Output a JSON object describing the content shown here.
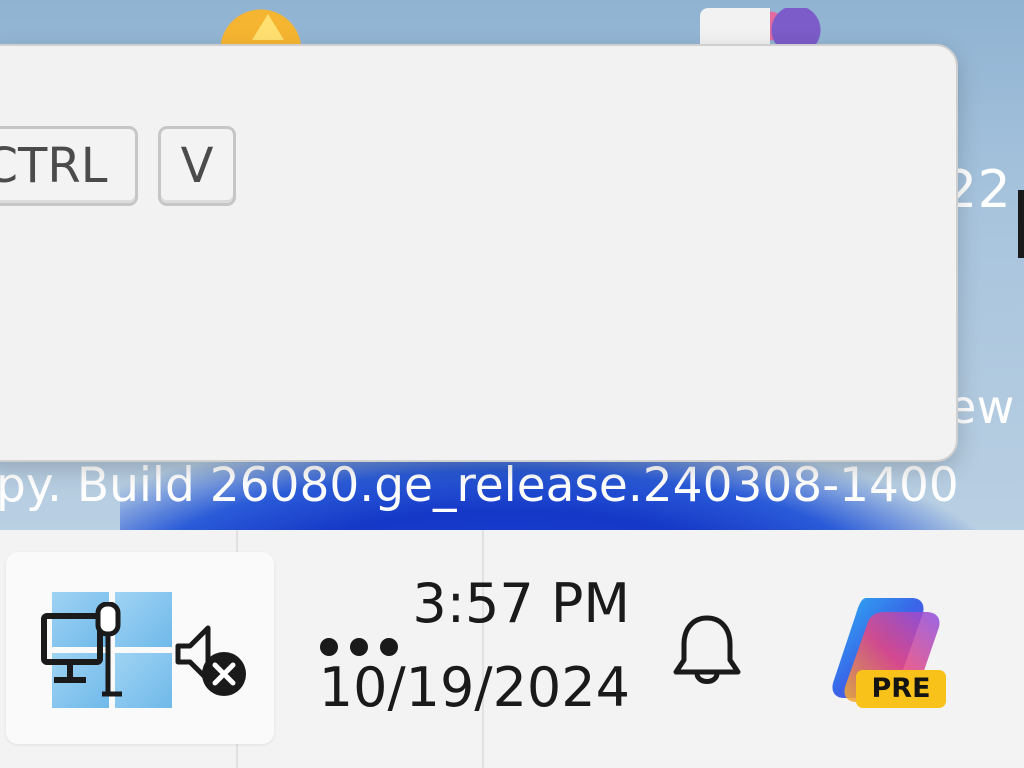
{
  "desktop": {
    "text_fragment_right_top": "22",
    "text_fragment_right_bottom": "ew",
    "watermark": "py. Build 26080.ge_release.240308-1400"
  },
  "overlay": {
    "keys": [
      "CTRL",
      "V"
    ]
  },
  "taskbar": {
    "icons": {
      "windows": "windows-start-icon",
      "network": "ethernet-network-icon",
      "volume": "volume-muted-icon",
      "overflow": "more-dots-icon",
      "notifications": "bell-icon",
      "copilot": "copilot-icon"
    },
    "clock": {
      "time": "3:57 PM",
      "date": "10/19/2024"
    },
    "copilot_badge": "PRE"
  },
  "colors": {
    "accent_blue": "#1538c7",
    "taskbar_bg": "#f3f3f3",
    "badge_yellow": "#f9c21b"
  }
}
